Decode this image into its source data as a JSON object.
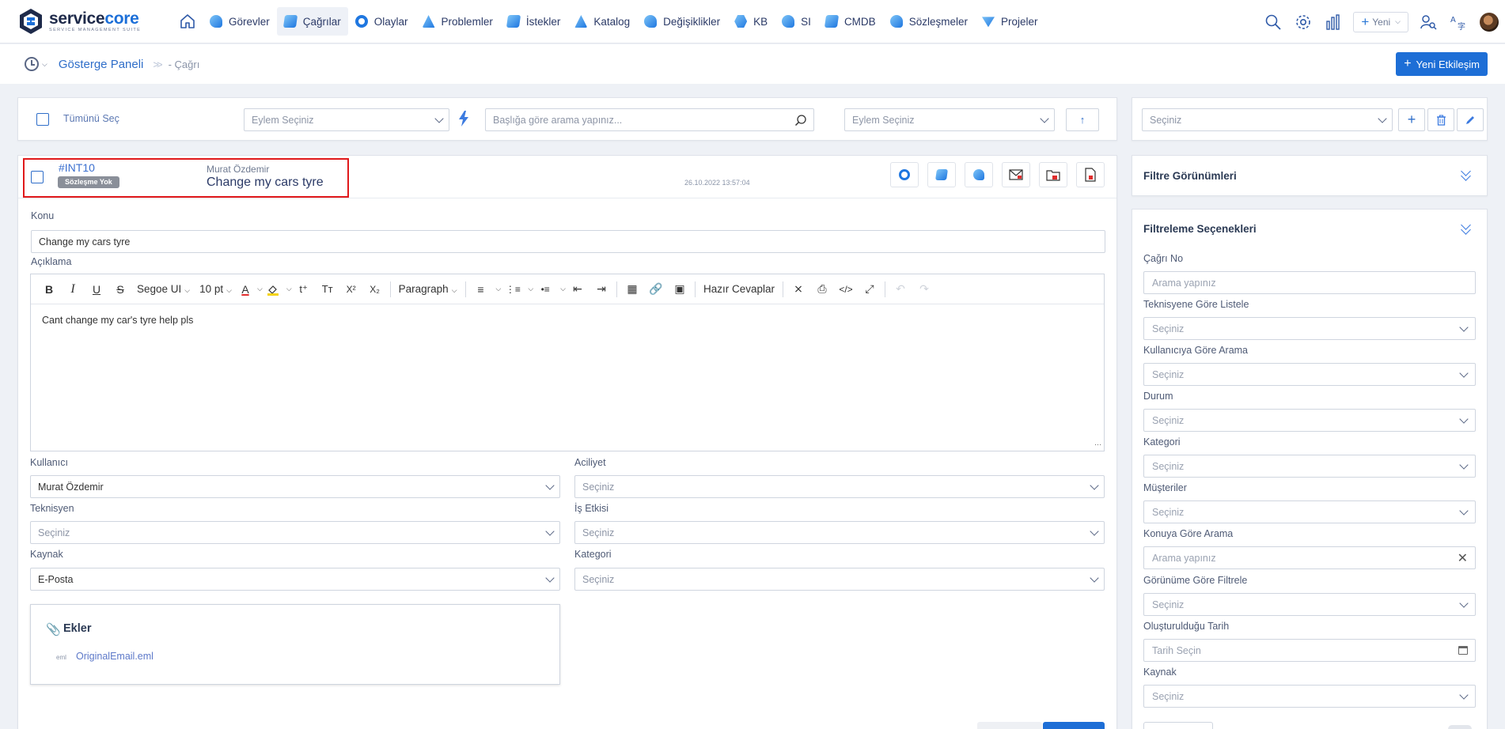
{
  "brand": {
    "name_dark": "service",
    "name_blue": "core",
    "tagline": "SERVICE MANAGEMENT SUITE"
  },
  "nav": {
    "items": [
      {
        "label": "Görevler",
        "icon": "tasks-icon"
      },
      {
        "label": "Çağrılar",
        "icon": "calls-icon",
        "active": true
      },
      {
        "label": "Olaylar",
        "icon": "incidents-icon"
      },
      {
        "label": "Problemler",
        "icon": "problems-icon"
      },
      {
        "label": "İstekler",
        "icon": "requests-icon"
      },
      {
        "label": "Katalog",
        "icon": "catalog-icon"
      },
      {
        "label": "Değişiklikler",
        "icon": "changes-icon"
      },
      {
        "label": "KB",
        "icon": "kb-icon"
      },
      {
        "label": "SI",
        "icon": "si-icon"
      },
      {
        "label": "CMDB",
        "icon": "cmdb-icon"
      },
      {
        "label": "Sözleşmeler",
        "icon": "contracts-icon"
      },
      {
        "label": "Projeler",
        "icon": "projects-icon"
      }
    ],
    "new_label": "Yeni"
  },
  "breadcrumb": {
    "root": "Gösterge Paneli",
    "current": "Çağrı"
  },
  "new_interaction_label": "Yeni Etkileşim",
  "toolbar": {
    "select_all": "Tümünü Seç",
    "action_select_1": "Eylem Seçiniz",
    "search_placeholder": "Başlığa göre arama yapınız...",
    "action_select_2": "Eylem Seçiniz",
    "view_select": "Seçiniz"
  },
  "ticket": {
    "id": "#INT10",
    "contract_badge": "Sözleşme Yok",
    "requester": "Murat Özdemir",
    "title": "Change my cars tyre",
    "datetime": "26.10.2022 13:57:04"
  },
  "form": {
    "subject_label": "Konu",
    "subject_value": "Change my cars tyre",
    "description_label": "Açıklama",
    "editor": {
      "font": "Segoe UI",
      "size": "10 pt",
      "block": "Paragraph",
      "ready_answers": "Hazır Cevaplar",
      "body": "Cant change my car's tyre help pls"
    },
    "user_label": "Kullanıcı",
    "user_value": "Murat Özdemir",
    "urgency_label": "Aciliyet",
    "urgency_value": "Seçiniz",
    "technician_label": "Teknisyen",
    "technician_value": "Seçiniz",
    "impact_label": "İş Etkisi",
    "impact_value": "Seçiniz",
    "source_label": "Kaynak",
    "source_value": "E-Posta",
    "category_label": "Kategori",
    "category_value": "Seçiniz",
    "attachments_title": "Ekler",
    "attachment_ext": "eml",
    "attachment_name": "OriginalEmail.eml"
  },
  "filters": {
    "views_title": "Filtre Görünümleri",
    "options_title": "Filtreleme Seçenekleri",
    "fields": [
      {
        "label": "Çağrı No",
        "value": "Arama yapınız",
        "kind": "text"
      },
      {
        "label": "Teknisyene Göre Listele",
        "value": "Seçiniz",
        "kind": "select"
      },
      {
        "label": "Kullanıcıya Göre Arama",
        "value": "Seçiniz",
        "kind": "select"
      },
      {
        "label": "Durum",
        "value": "Seçiniz",
        "kind": "select"
      },
      {
        "label": "Kategori",
        "value": "Seçiniz",
        "kind": "select"
      },
      {
        "label": "Müşteriler",
        "value": "Seçiniz",
        "kind": "select"
      },
      {
        "label": "Konuya Göre Arama",
        "value": "Arama yapınız",
        "kind": "clear"
      },
      {
        "label": "Görünüme Göre Filtrele",
        "value": "Seçiniz",
        "kind": "select"
      },
      {
        "label": "Oluşturulduğu Tarih",
        "value": "Tarih Seçin",
        "kind": "date"
      },
      {
        "label": "Kaynak",
        "value": "Seçiniz",
        "kind": "select"
      }
    ]
  },
  "colors": {
    "accent": "#1d6ed6",
    "highlight": "#e0191b",
    "badge": "#8a8f99"
  }
}
